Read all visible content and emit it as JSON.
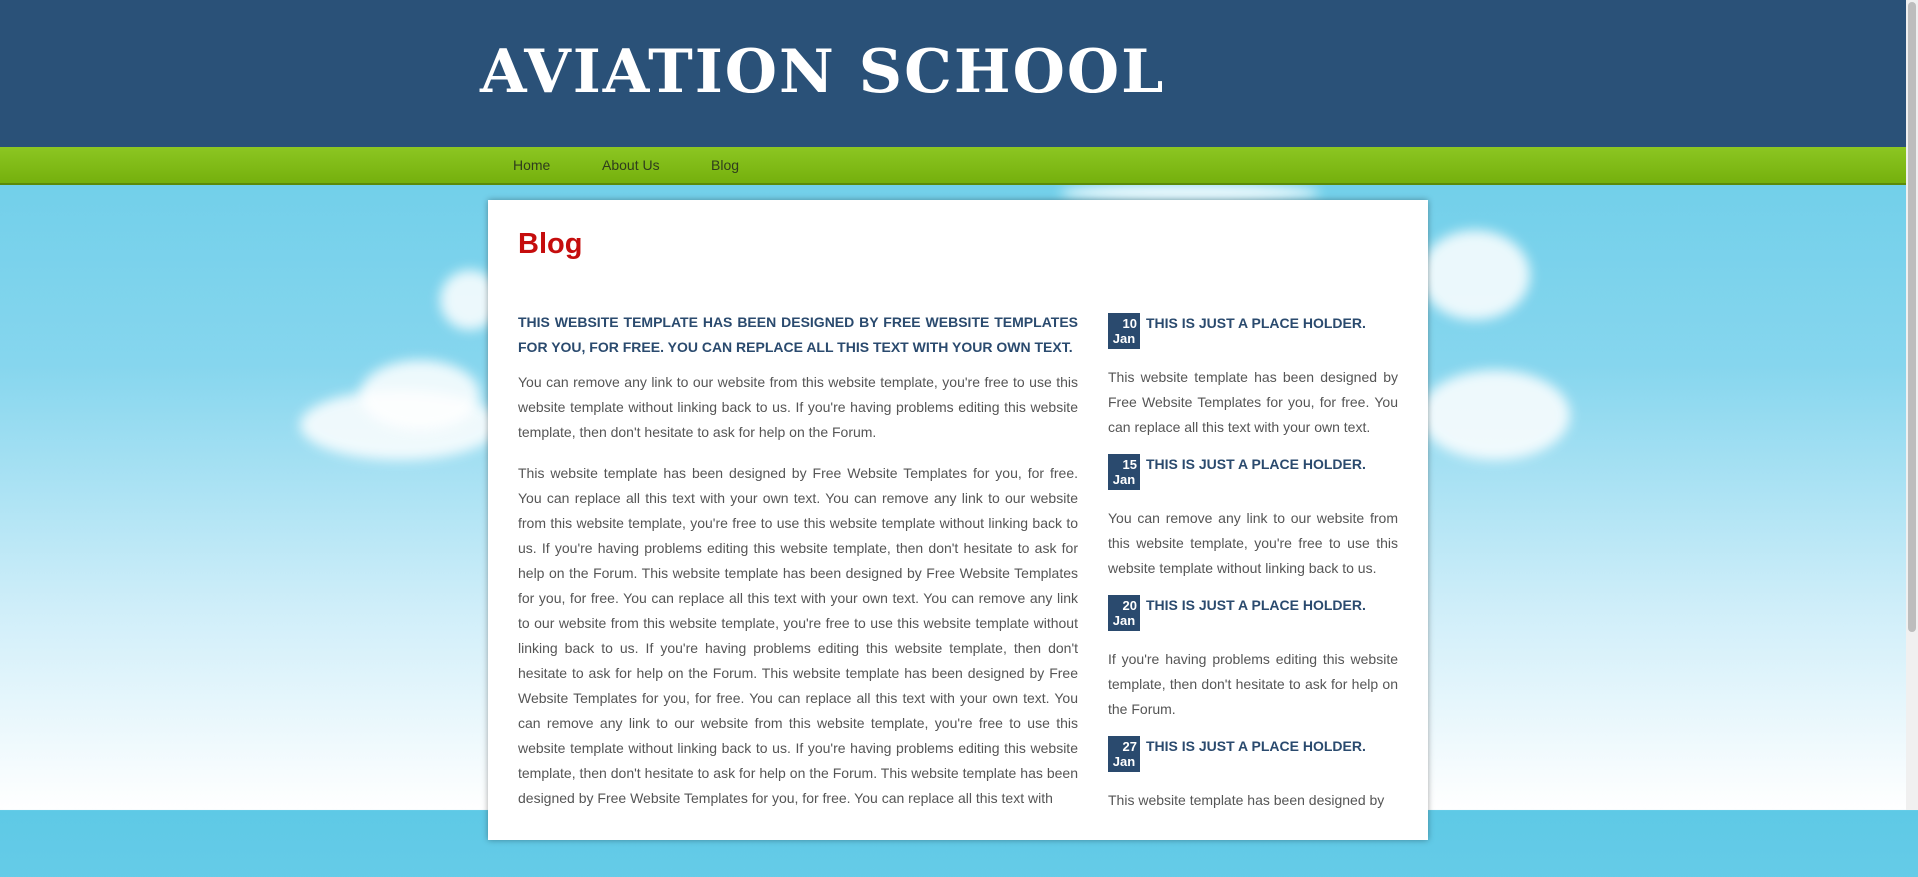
{
  "header": {
    "logo": "AVIATION SCHOOL"
  },
  "nav": {
    "items": [
      "Home",
      "About Us",
      "Blog"
    ]
  },
  "page": {
    "title": "Blog"
  },
  "main": {
    "heading": "This website template has been designed by Free Website Templates for you, for free. You can replace all this text with your own text.",
    "paragraphs": [
      "You can remove any link to our website from this website template, you're free to use this website template without linking back to us. If you're having problems editing this website template, then don't hesitate to ask for help on the Forum.",
      "This website template has been designed by Free Website Templates for you, for free. You can replace all this text with your own text. You can remove any link to our website from this website template, you're free to use this website template without linking back to us. If you're having problems editing this website template, then don't hesitate to ask for help on the Forum. This website template has been designed by Free Website Templates for you, for free. You can replace all this text with your own text. You can remove any link to our website from this website template, you're free to use this website template without linking back to us. If you're having problems editing this website template, then don't hesitate to ask for help on the Forum. This website template has been designed by Free Website Templates for you, for free. You can replace all this text with your own text. You can remove any link to our website from this website template, you're free to use this website template without linking back to us. If you're having problems editing this website template, then don't hesitate to ask for help on the Forum. This website template has been designed by Free Website Templates for you, for free. You can replace all this text with"
    ]
  },
  "sidebar": {
    "posts": [
      {
        "day": "10",
        "month": "Jan",
        "title": "This is just a place holder.",
        "text": "This website template has been designed by Free Website Templates for you, for free. You can replace all this text with your own text."
      },
      {
        "day": "15",
        "month": "Jan",
        "title": "This is just a place holder.",
        "text": "You can remove any link to our website from this website template, you're free to use this website template without linking back to us."
      },
      {
        "day": "20",
        "month": "Jan",
        "title": "This is just a place holder.",
        "text": "If you're having problems editing this website template, then don't hesitate to ask for help on the Forum."
      },
      {
        "day": "27",
        "month": "Jan",
        "title": "This is just a place holder.",
        "text": "This website template has been designed by"
      }
    ]
  },
  "colors": {
    "header_bg": "#2a5178",
    "nav_bg": "#7fbb14",
    "title_red": "#c50d0d",
    "heading_blue": "#2a4a6e"
  }
}
